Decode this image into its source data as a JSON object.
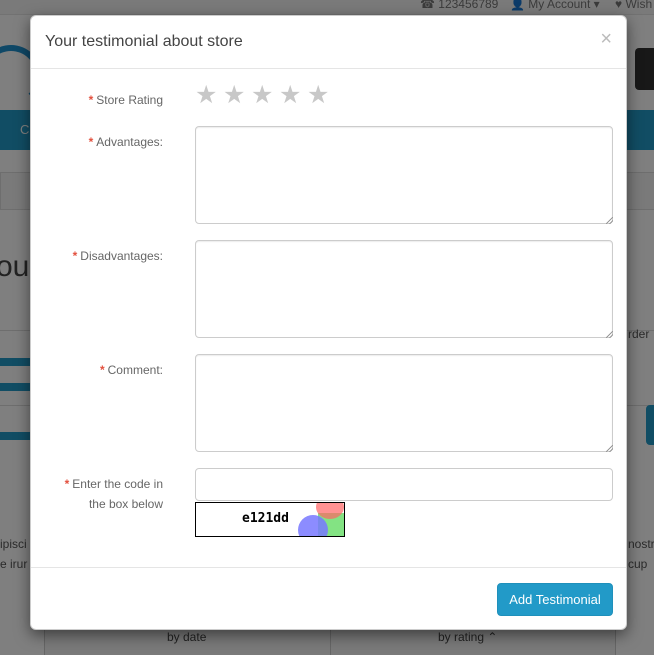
{
  "background": {
    "topbar": {
      "phone": "123456789",
      "account": "My Account",
      "wishlist": "Wish"
    },
    "menu_label": "C",
    "heading_fragment": "ou",
    "sort_fragment": "rder",
    "text_left_1": "ipisci",
    "text_left_2": "e irur",
    "text_right_1": "nostr",
    "text_right_2": "cup",
    "tabs": {
      "by_date": "by date",
      "by_rating": "by rating"
    }
  },
  "modal": {
    "title": "Your testimonial about store",
    "close_symbol": "×",
    "rating": {
      "label": "Store Rating",
      "required": "*",
      "stars": [
        "★",
        "★",
        "★",
        "★",
        "★"
      ],
      "value": 0
    },
    "advantages": {
      "label": "Advantages:",
      "required": "*",
      "value": ""
    },
    "disadvantages": {
      "label": "Disadvantages:",
      "required": "*",
      "value": ""
    },
    "comment": {
      "label": "Comment:",
      "required": "*",
      "value": ""
    },
    "captcha": {
      "label_line1": "Enter the code in",
      "label_line2": "the box below",
      "required": "*",
      "code": "e121dd",
      "value": ""
    },
    "submit_label": "Add Testimonial"
  },
  "colors": {
    "accent": "#229ac8",
    "required": "#e3503e",
    "star_empty": "#c8c8c8"
  }
}
